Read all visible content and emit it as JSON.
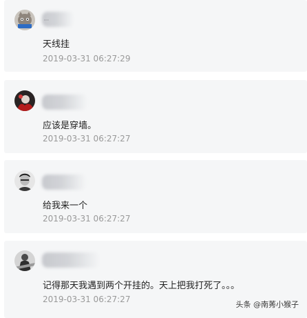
{
  "comments": [
    {
      "text": "天线挂",
      "timestamp": "2019-03-31 06:27:29",
      "avatar": "cat-avatar"
    },
    {
      "text": "应该是穿墙。",
      "timestamp": "2019-03-31 06:27:27",
      "avatar": "red-dark-avatar"
    },
    {
      "text": "给我来一个",
      "timestamp": "2019-03-31 06:27:27",
      "avatar": "portrait-avatar"
    },
    {
      "text": "记得那天我遇到两个开挂的。天上把我打死了。。。",
      "timestamp": "2019-03-31 06:27:27",
      "avatar": "figure-avatar"
    }
  ],
  "watermark": "头条 @南莠小猴子"
}
